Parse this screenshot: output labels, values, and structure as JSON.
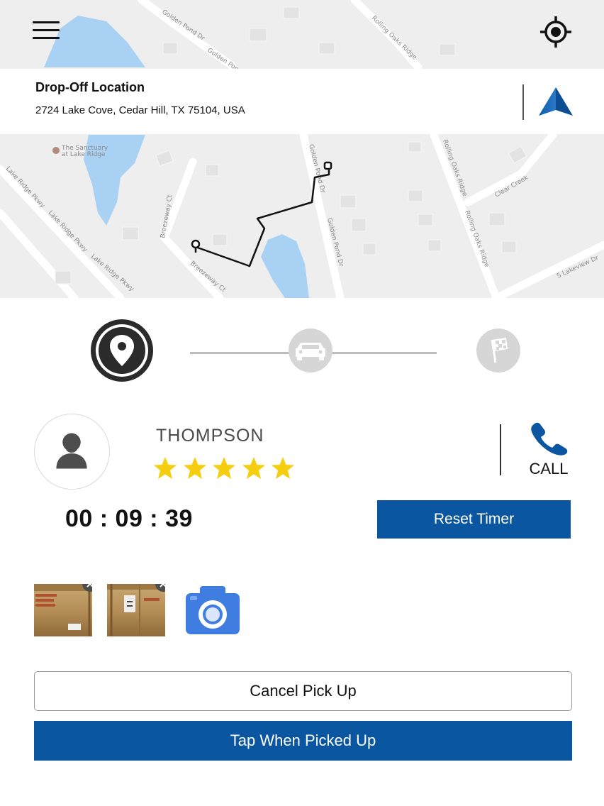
{
  "map": {
    "streets": [
      "Golden Pond Dr",
      "Rolling Oaks Ridge",
      "Lake Ridge Pkwy",
      "Breezeway Ct",
      "Clear Creek",
      "S Lakeview Dr"
    ],
    "place": "The Sanctuary at Lake Ridge",
    "place_line1": "The Sanctuary",
    "place_line2": "at Lake Ridge"
  },
  "header": {
    "menu_icon": "hamburger-menu-icon",
    "locate_icon": "crosshair-locate-icon"
  },
  "dropoff": {
    "title": "Drop-Off Location",
    "address": "2724 Lake Cove, Cedar Hill, TX 75104, USA",
    "nav_icon": "navigation-arrow-icon"
  },
  "progress_steps": [
    {
      "name": "pickup",
      "icon": "location-pin-icon",
      "active": true
    },
    {
      "name": "in-transit",
      "icon": "car-icon",
      "active": false
    },
    {
      "name": "finish",
      "icon": "checkered-flag-icon",
      "active": false
    }
  ],
  "customer": {
    "name": "THOMPSON",
    "rating": 5,
    "rating_max": 5,
    "call_label": "CALL"
  },
  "timer": {
    "value": "00 : 09 : 39",
    "reset_label": "Reset Timer"
  },
  "photos": {
    "count": 2,
    "camera_icon": "camera-icon"
  },
  "actions": {
    "cancel_label": "Cancel Pick Up",
    "picked_label": "Tap When Picked Up"
  },
  "colors": {
    "primary": "#0a56a0",
    "star": "#f5cf0f",
    "map_bg": "#eeeeee",
    "water": "#a9d1f3"
  }
}
